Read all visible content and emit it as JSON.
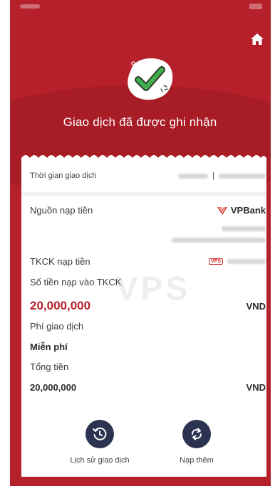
{
  "header": {
    "title": "Giao dịch đã được ghi nhận"
  },
  "transaction": {
    "time_label": "Thời gian giao dịch",
    "time_separator": "|",
    "source_label": "Nguồn nạp tiền",
    "bank_name": "VPBank",
    "account_label": "TKCK nạp tiền",
    "vps_logo_text": "VPS",
    "deposit_label": "Số tiền nạp vào TKCK",
    "deposit_amount": "20,000,000",
    "deposit_currency": "VND",
    "fee_label": "Phí giao dịch",
    "fee_value": "Miễn phí",
    "total_label": "Tổng tiền",
    "total_amount": "20,000,000",
    "total_currency": "VND"
  },
  "watermark": "VPS",
  "actions": {
    "history_label": "Lịch sử giao dịch",
    "topup_label": "Nạp thêm"
  },
  "colors": {
    "brand_red": "#b5202a",
    "button_navy": "#2b3350",
    "success_green": "#3fae4b"
  }
}
